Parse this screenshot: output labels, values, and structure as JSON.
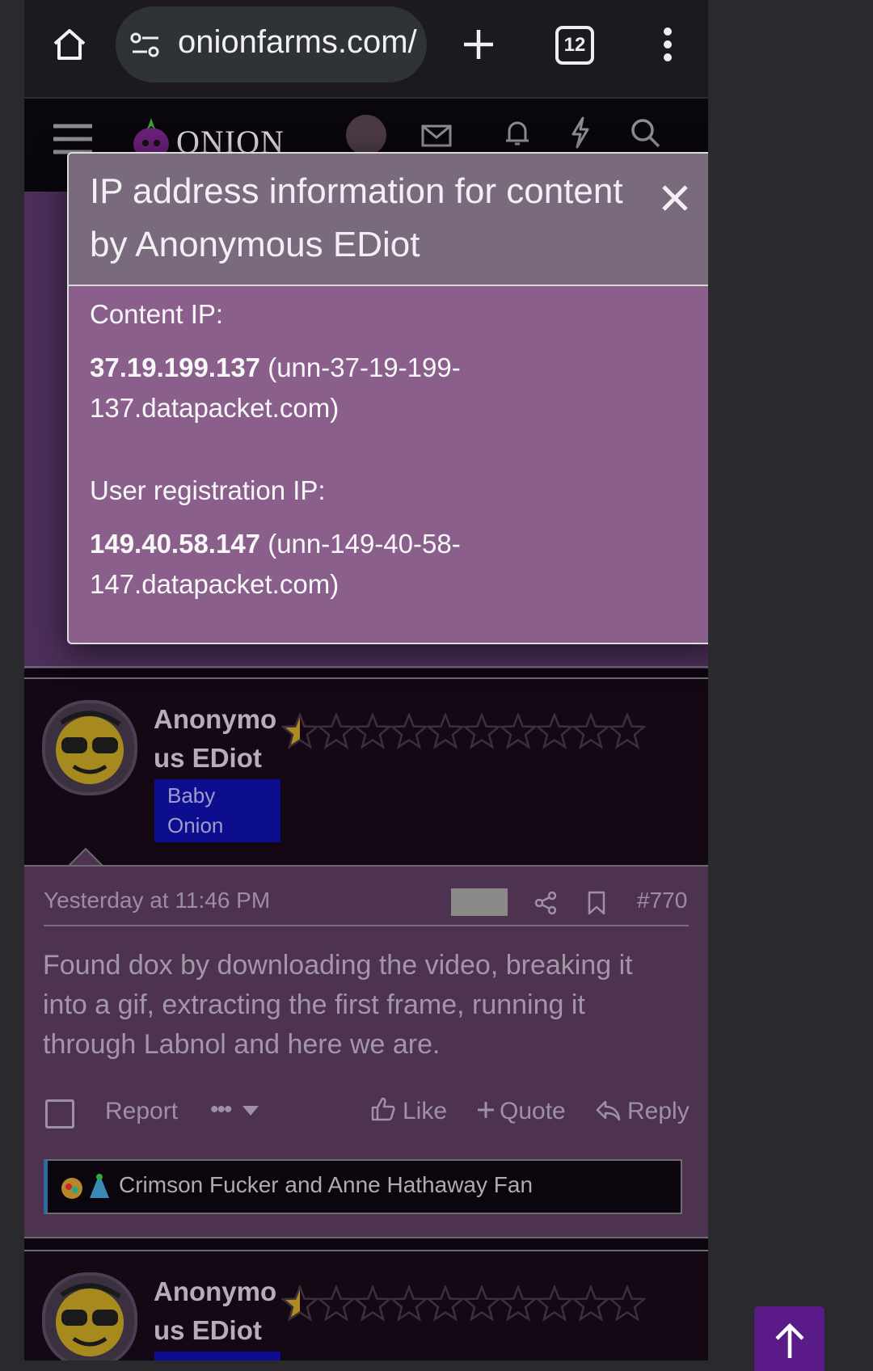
{
  "browser": {
    "url": "onionfarms.com/",
    "tab_count": "12",
    "icons": [
      "home-icon",
      "site-settings-icon",
      "new-tab-icon",
      "tab-switcher-icon",
      "more-vert-icon"
    ]
  },
  "site": {
    "logo_text": "ONION",
    "header_icons": [
      "menu-icon",
      "avatar",
      "inbox-icon",
      "bell-icon",
      "bolt-icon",
      "search-icon"
    ]
  },
  "modal": {
    "title": "IP address information for content by Anonymous EDiot",
    "content_ip_label": "Content IP:",
    "content_ip": "37.19.199.137",
    "content_host": "(unn-37-19-199-137.datapacket.com)",
    "registration_ip_label": "User registration IP:",
    "registration_ip": "149.40.58.147",
    "registration_host": "(unn-149-40-58-147.datapacket.com)"
  },
  "posts": [
    {
      "username": "Anonymous EDiot",
      "username_line1": "Anonymo",
      "username_line2": "us EDiot",
      "badge": "Baby Onion",
      "badge_line1": "Baby",
      "badge_line2": "Onion",
      "rating_stars": 10,
      "rating_value": 0.5,
      "timestamp": "Yesterday at 11:46 PM",
      "post_number": "#770",
      "body": "Found dox by downloading the video, breaking it into a gif, extracting the first frame, running it through Labnol and here we are.",
      "actions": {
        "report": "Report",
        "more": "•••",
        "like": "Like",
        "quote": "Quote",
        "reply": "Reply"
      },
      "reactions_text": "Crimson Fucker and Anne Hathaway Fan"
    },
    {
      "username_line1": "Anonymo",
      "username_line2": "us EDiot"
    }
  ],
  "colors": {
    "modal_body": "#8a5f8c",
    "modal_header": "#7a6a7e",
    "badge": "#0d0d8f",
    "scroll_top": "#5a1a87"
  }
}
